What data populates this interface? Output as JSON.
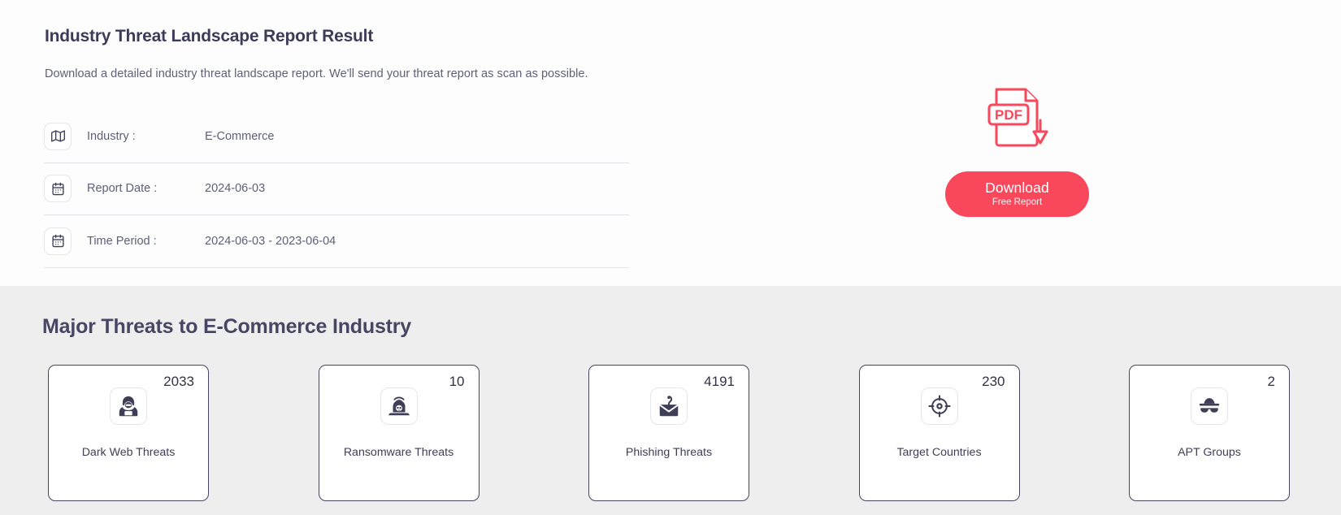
{
  "report": {
    "title": "Industry Threat Landscape Report Result",
    "description": "Download a detailed industry threat landscape report. We'll send your threat report as scan as possible.",
    "rows": [
      {
        "icon": "map-icon",
        "label": "Industry :",
        "value": "E-Commerce"
      },
      {
        "icon": "calendar-icon",
        "label": "Report Date :",
        "value": "2024-06-03"
      },
      {
        "icon": "calendar-icon",
        "label": "Time Period :",
        "value": "2024-06-03 - 2023-06-04"
      }
    ],
    "pdf_icon": "pdf-download-icon",
    "pdf_badge_text": "PDF",
    "download": {
      "main_label": "Download",
      "sub_label": "Free Report",
      "accent_color": "#f9485b"
    }
  },
  "threats": {
    "title": "Major Threats to E-Commerce Industry",
    "cards": [
      {
        "count": "2033",
        "label": "Dark Web Threats",
        "icon": "hacker-icon"
      },
      {
        "count": "10",
        "label": "Ransomware Threats",
        "icon": "ransomware-laptop-skull-icon"
      },
      {
        "count": "4191",
        "label": "Phishing Threats",
        "icon": "phishing-envelope-hook-icon"
      },
      {
        "count": "230",
        "label": "Target Countries",
        "icon": "crosshair-target-icon"
      },
      {
        "count": "2",
        "label": "APT Groups",
        "icon": "spy-icon"
      }
    ]
  },
  "theme": {
    "section_bg": "#eeeeee",
    "card_border": "#46455f",
    "text_dark": "#3d3c58",
    "text_muted": "#5f6076"
  }
}
